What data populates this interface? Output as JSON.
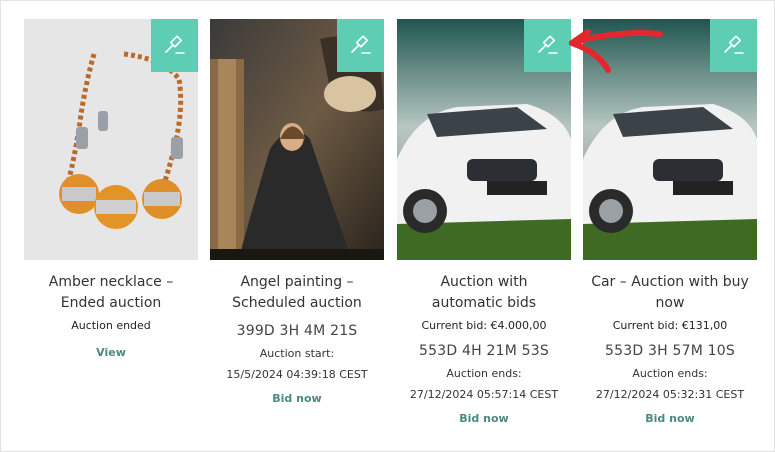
{
  "colors": {
    "badge": "#5dcdb3",
    "link": "#4a8a7f",
    "arrow": "#e2282d"
  },
  "badge_icon": "auction-hammer-icon",
  "cards": [
    {
      "title": "Amber necklace – Ended auction",
      "status": "Auction ended",
      "link": "View"
    },
    {
      "title": "Angel painting – Scheduled auction",
      "countdown": "399D 3H 4M 21S",
      "time_label": "Auction start:",
      "time": "15/5/2024 04:39:18 CEST",
      "link": "Bid now"
    },
    {
      "title": "Auction with automatic bids",
      "current_bid": "Current bid: €4.000,00",
      "countdown": "553D 4H 21M 53S",
      "time_label": "Auction ends:",
      "time": "27/12/2024 05:57:14 CEST",
      "link": "Bid now"
    },
    {
      "title": "Car – Auction with buy now",
      "current_bid": "Current bid: €131,00",
      "countdown": "553D 3H 57M 10S",
      "time_label": "Auction ends:",
      "time": "27/12/2024 05:32:31 CEST",
      "link": "Bid now"
    }
  ]
}
